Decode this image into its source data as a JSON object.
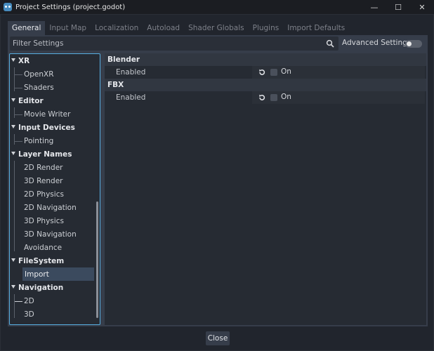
{
  "window": {
    "title": "Project Settings (project.godot)",
    "controls": {
      "minimize": "—",
      "maximize": "☐",
      "close": "✕"
    }
  },
  "tabs": [
    "General",
    "Input Map",
    "Localization",
    "Autoload",
    "Shader Globals",
    "Plugins",
    "Import Defaults"
  ],
  "active_tab": "General",
  "filter": {
    "placeholder": "Filter Settings",
    "value": ""
  },
  "advanced_settings": {
    "label": "Advanced Settings",
    "enabled": false
  },
  "tree": {
    "sections": [
      {
        "label": "XR",
        "children": [
          "OpenXR",
          "Shaders"
        ]
      },
      {
        "label": "Editor",
        "children": [
          "Movie Writer"
        ]
      },
      {
        "label": "Input Devices",
        "children": [
          "Pointing"
        ]
      },
      {
        "label": "Layer Names",
        "children": [
          "2D Render",
          "3D Render",
          "2D Physics",
          "2D Navigation",
          "3D Physics",
          "3D Navigation",
          "Avoidance"
        ]
      },
      {
        "label": "FileSystem",
        "children": [
          "Import"
        ]
      },
      {
        "label": "Navigation",
        "children": [
          "2D",
          "3D"
        ]
      }
    ],
    "selected": "Import"
  },
  "inspector": {
    "categories": [
      {
        "label": "Blender",
        "properties": [
          {
            "label": "Enabled",
            "value": "On",
            "checked": false
          }
        ]
      },
      {
        "label": "FBX",
        "properties": [
          {
            "label": "Enabled",
            "value": "On",
            "checked": false
          }
        ]
      }
    ]
  },
  "footer": {
    "close_label": "Close"
  },
  "colors": {
    "accent": "#57aee0",
    "background": "#21252d",
    "panel": "#363d4a",
    "selected": "#3b4a5e"
  }
}
